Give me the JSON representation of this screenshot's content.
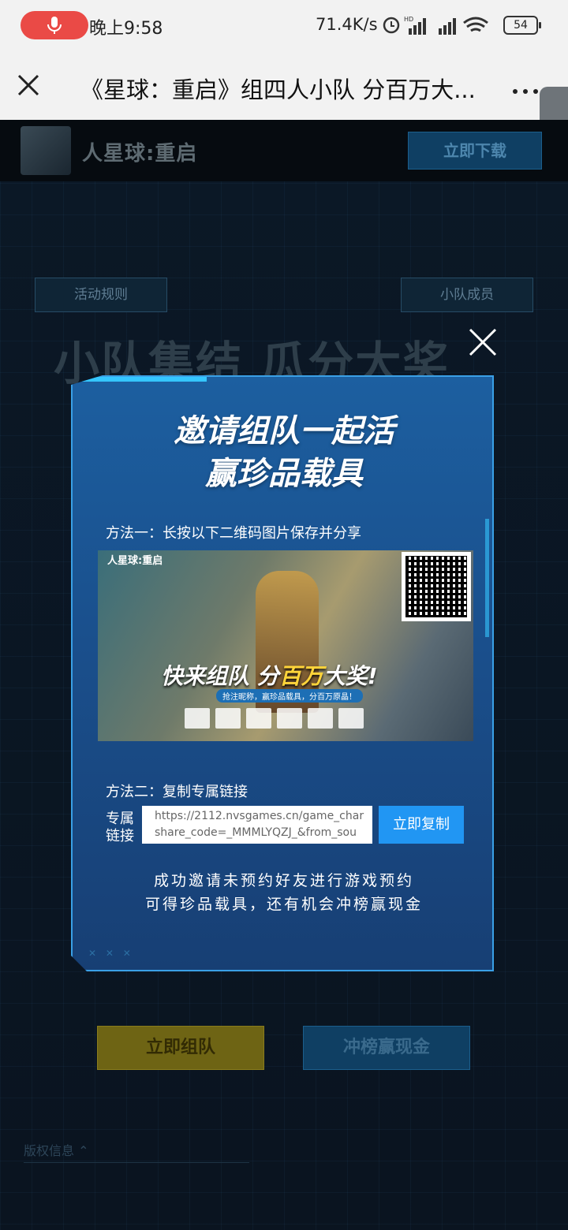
{
  "status_bar": {
    "time": "晚上9:58",
    "network_speed": "71.4K/s",
    "battery": "54",
    "icons": [
      "microphone-icon",
      "alarm-icon",
      "hd-signal-icon",
      "signal-icon",
      "wifi-icon",
      "battery-icon"
    ]
  },
  "browser": {
    "title": "《星球：重启》组四人小队 分百万大...",
    "icons": [
      "close-icon",
      "more-icon",
      "chevron-left-icon"
    ]
  },
  "game_header": {
    "logo": "人星球:重启",
    "download_button": "立即下载"
  },
  "page": {
    "rules_button": "活动规则",
    "members_button": "小队成员",
    "big_title": "小队集结 瓜分大奖",
    "team_button": "立即组队",
    "rank_button": "冲榜赢现金",
    "copyright": "版权信息"
  },
  "modal": {
    "title_line1": "邀请组队一起活",
    "title_line2": "赢珍品载具",
    "method1": "方法一：长按以下二维码图片保存并分享",
    "poster": {
      "logo": "人星球:重启",
      "slogan_a": "快来组队 分",
      "slogan_b": "百万",
      "slogan_c": "大奖!",
      "sub": "抢注昵称，赢珍品载具，分百万原晶！"
    },
    "method2": "方法二：复制专属链接",
    "link_label": "专属链接",
    "link_line1": "https://2112.nvsgames.cn/game_char",
    "link_line2": "share_code=_MMMLYQZJ_&from_sou",
    "copy_button": "立即复制",
    "tip_line1": "成功邀请未预约好友进行游戏预约",
    "tip_line2": "可得珍品载具，还有机会冲榜赢现金"
  },
  "colors": {
    "accent_blue": "#2196f3",
    "modal_bg": "#1c5fa0",
    "mic_red": "#ea4a46"
  }
}
